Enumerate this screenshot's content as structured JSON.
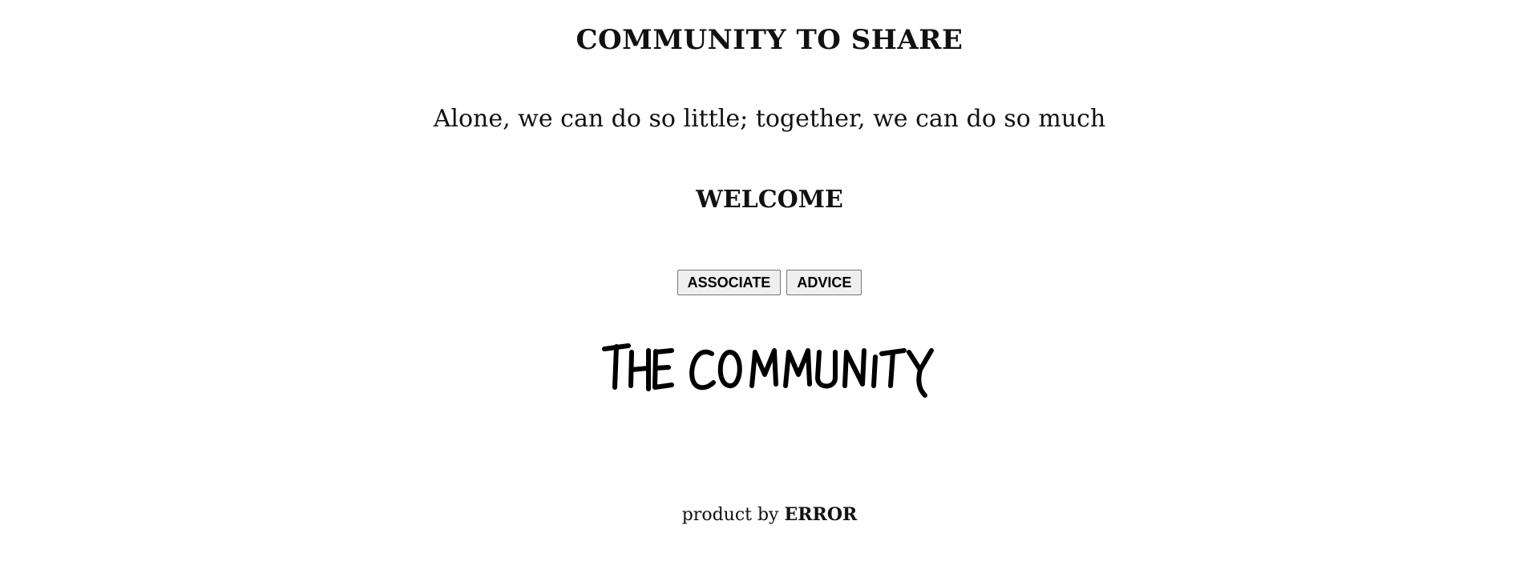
{
  "header": {
    "title": "COMMUNITY TO SHARE",
    "tagline": "Alone, we can do so little; together, we can do so much",
    "welcome": "WELCOME"
  },
  "buttons": {
    "associate_label": "ASSOCIATE",
    "advice_label": "ADVICE"
  },
  "logo": {
    "text": "THE COMMUNITY"
  },
  "footer": {
    "prefix": "product by",
    "brand": "ERROR"
  }
}
